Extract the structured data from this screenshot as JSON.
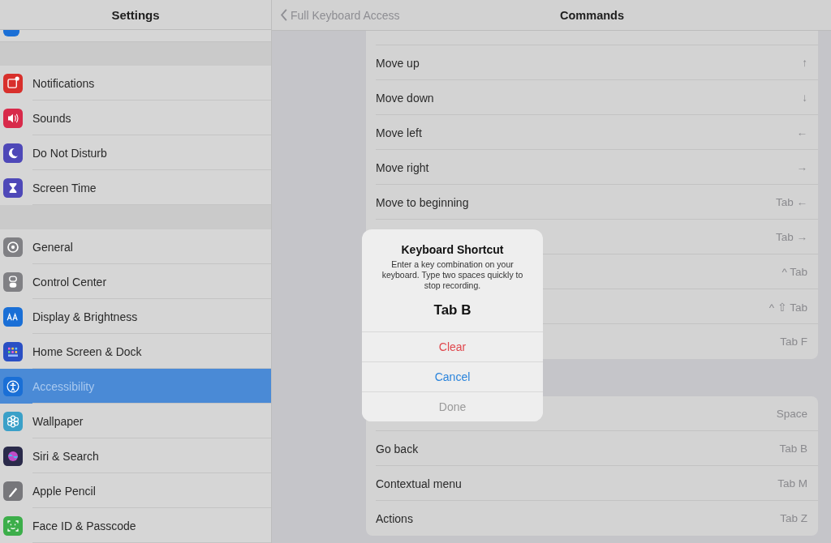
{
  "sidebar": {
    "title": "Settings",
    "groups": [
      [
        {
          "label": "Notifications",
          "color": "#d8302c",
          "selected": false
        },
        {
          "label": "Sounds",
          "color": "#d82a4a",
          "selected": false
        },
        {
          "label": "Do Not Disturb",
          "color": "#4e48b8",
          "selected": false
        },
        {
          "label": "Screen Time",
          "color": "#4e48b8",
          "selected": false
        }
      ],
      [
        {
          "label": "General",
          "color": "#808084",
          "selected": false
        },
        {
          "label": "Control Center",
          "color": "#808084",
          "selected": false
        },
        {
          "label": "Display & Brightness",
          "color": "#1a6fd6",
          "selected": false
        },
        {
          "label": "Home Screen & Dock",
          "color": "#2a4fc4",
          "selected": false
        },
        {
          "label": "Accessibility",
          "color": "#1a6fd6",
          "selected": true
        },
        {
          "label": "Wallpaper",
          "color": "#3aa0c8",
          "selected": false
        },
        {
          "label": "Siri & Search",
          "color": "#2a2a4a",
          "selected": false
        },
        {
          "label": "Apple Pencil",
          "color": "#77777b",
          "selected": false
        },
        {
          "label": "Face ID & Passcode",
          "color": "#3cae4a",
          "selected": false
        }
      ]
    ]
  },
  "nav": {
    "back": "Full Keyboard Access",
    "title": "Commands"
  },
  "groups": [
    [
      {
        "label": "Move up",
        "shortcut": "↑"
      },
      {
        "label": "Move down",
        "shortcut": "↓"
      },
      {
        "label": "Move left",
        "shortcut": "←"
      },
      {
        "label": "Move right",
        "shortcut": "→"
      },
      {
        "label": "Move to beginning",
        "shortcut": "Tab ←"
      },
      {
        "shortcut": "Tab →"
      },
      {
        "shortcut": "^ Tab"
      },
      {
        "shortcut": "^ ⇧ Tab"
      },
      {
        "shortcut": "Tab F"
      }
    ],
    [
      {
        "shortcut": "Space"
      },
      {
        "label": "Go back",
        "shortcut": "Tab B"
      },
      {
        "label": "Contextual menu",
        "shortcut": "Tab M"
      },
      {
        "label": "Actions",
        "shortcut": "Tab Z"
      }
    ]
  ],
  "dialog": {
    "title": "Keyboard Shortcut",
    "message": "Enter a key combination on your keyboard. Type two spaces quickly to stop recording.",
    "value": "Tab B",
    "buttons": [
      {
        "label": "Clear",
        "kind": "destructive"
      },
      {
        "label": "Cancel",
        "kind": "default"
      },
      {
        "label": "Done",
        "kind": "disabled"
      }
    ]
  }
}
